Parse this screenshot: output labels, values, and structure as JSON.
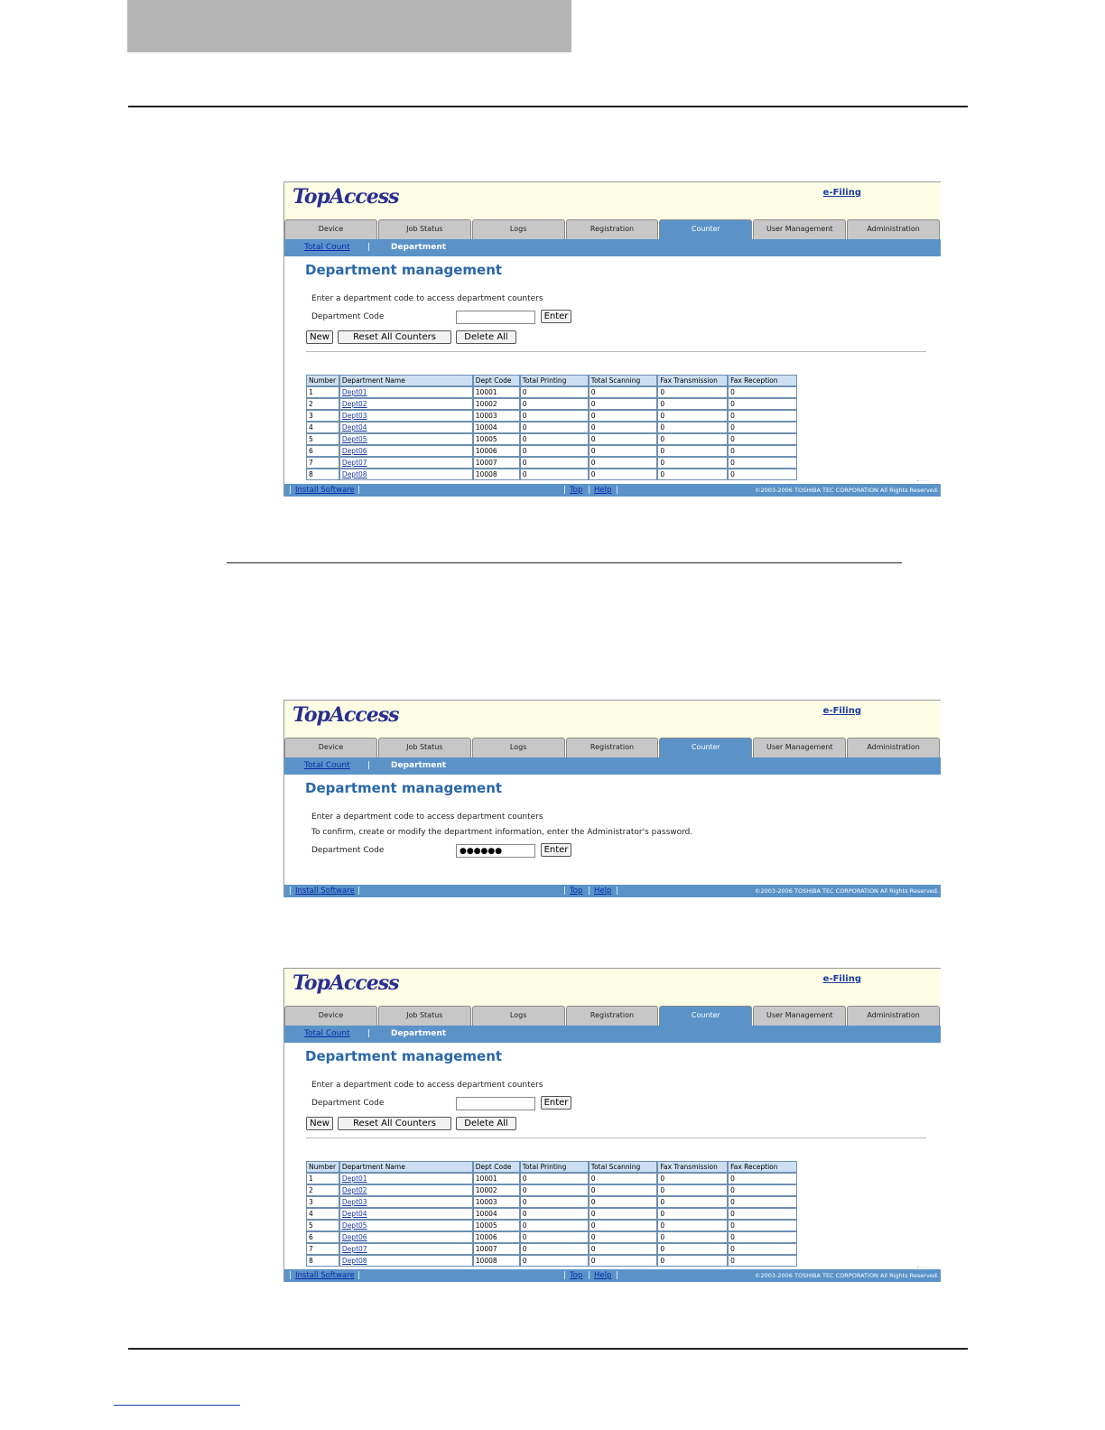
{
  "app": {
    "logo": "TopAccess",
    "efiling": "e-Filing",
    "tabs": [
      "Device",
      "Job Status",
      "Logs",
      "Registration",
      "Counter",
      "User Management",
      "Administration"
    ],
    "active_tab": "Counter",
    "subnav": {
      "total_count": "Total Count",
      "separator": "|",
      "department": "Department"
    },
    "page_title": "Department management",
    "instruction": "Enter a department code to access department counters",
    "confirm_text": "To confirm, create or modify the department information, enter the Administrator's password.",
    "dept_code_label": "Department Code",
    "password_value": "●●●●●●",
    "buttons": {
      "enter": "Enter",
      "new": "New",
      "reset_all": "Reset All Counters",
      "delete_all": "Delete All"
    },
    "table": {
      "headers": [
        "Number",
        "Department Name",
        "Dept Code",
        "Total Printing",
        "Total Scanning",
        "Fax Transmission",
        "Fax Reception"
      ],
      "rows": [
        [
          "1",
          "Dept01",
          "10001",
          "0",
          "0",
          "0",
          "0"
        ],
        [
          "2",
          "Dept02",
          "10002",
          "0",
          "0",
          "0",
          "0"
        ],
        [
          "3",
          "Dept03",
          "10003",
          "0",
          "0",
          "0",
          "0"
        ],
        [
          "4",
          "Dept04",
          "10004",
          "0",
          "0",
          "0",
          "0"
        ],
        [
          "5",
          "Dept05",
          "10005",
          "0",
          "0",
          "0",
          "0"
        ],
        [
          "6",
          "Dept06",
          "10006",
          "0",
          "0",
          "0",
          "0"
        ],
        [
          "7",
          "Dept07",
          "10007",
          "0",
          "0",
          "0",
          "0"
        ],
        [
          "8",
          "Dept08",
          "10008",
          "0",
          "0",
          "0",
          "0"
        ]
      ]
    },
    "footer": {
      "install": "Install Software",
      "top": "Top",
      "help": "Help",
      "pipe": "|",
      "copyright": "©2003-2006 TOSHIBA TEC CORPORATION All Rights Reserved."
    }
  }
}
